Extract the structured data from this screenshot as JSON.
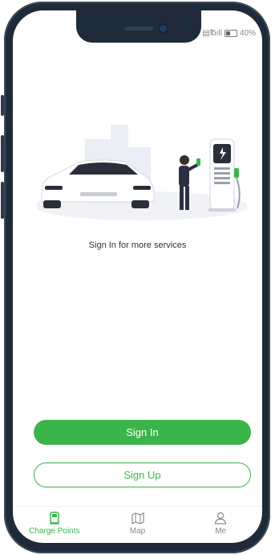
{
  "status_bar": {
    "battery": "40%"
  },
  "main": {
    "subtitle": "Sign In for more services",
    "sign_in_label": "Sign In",
    "sign_up_label": "Sign Up"
  },
  "tabbar": {
    "tabs": [
      {
        "label": "Charge Points",
        "icon": "charge-point-icon",
        "active": true
      },
      {
        "label": "Map",
        "icon": "map-icon",
        "active": false
      },
      {
        "label": "Me",
        "icon": "person-icon",
        "active": false
      }
    ]
  },
  "colors": {
    "accent": "#3bb54a",
    "frame": "#1f2b38"
  }
}
